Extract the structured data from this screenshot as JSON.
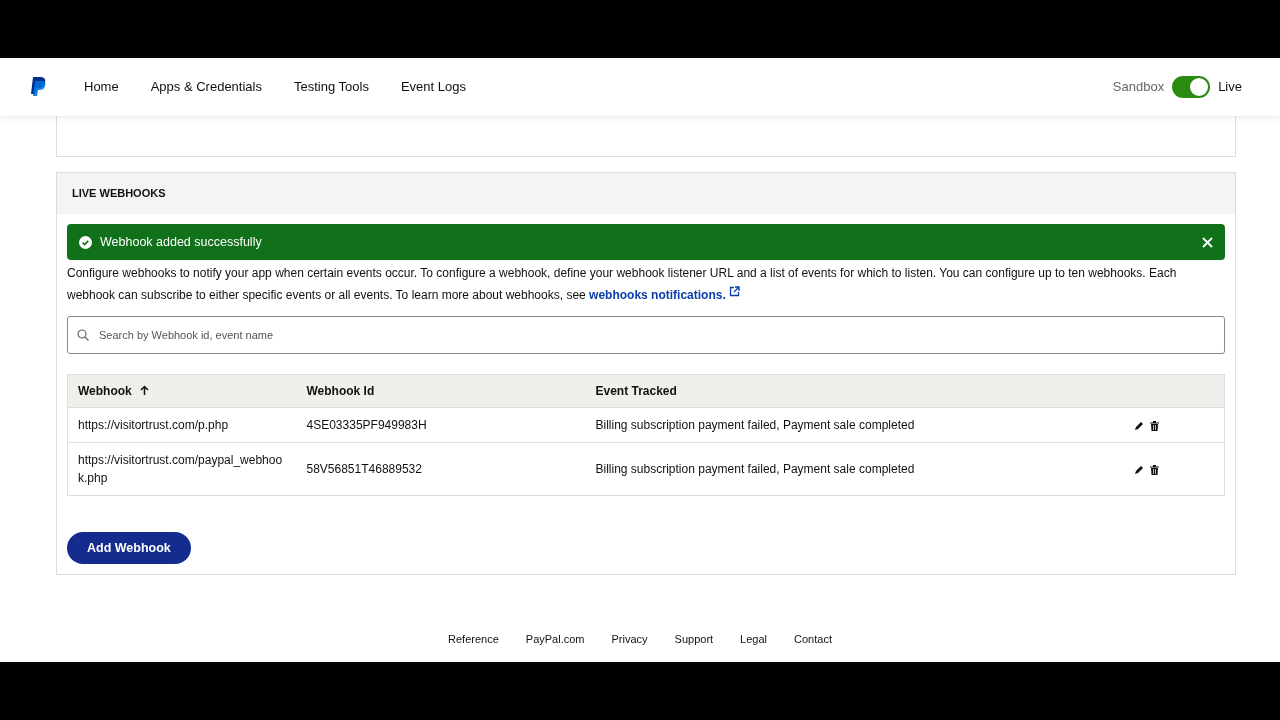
{
  "navbar": {
    "links": [
      {
        "label": "Home"
      },
      {
        "label": "Apps & Credentials"
      },
      {
        "label": "Testing Tools"
      },
      {
        "label": "Event Logs"
      }
    ],
    "mode_toggle": {
      "off_label": "Sandbox",
      "on_label": "Live",
      "on": true
    }
  },
  "section": {
    "title": "LIVE WEBHOOKS",
    "alert": {
      "message": "Webhook added successfully"
    },
    "description": "Configure webhooks to notify your app when certain events occur. To configure a webhook, define your webhook listener URL and a list of events for which to listen. You can configure up to ten webhooks. Each webhook can subscribe to either specific events or all events. To learn more about webhooks, see",
    "description_link": "webhooks notifications.",
    "search": {
      "placeholder": "Search by Webhook id, event name"
    },
    "table": {
      "columns": [
        {
          "label": "Webhook",
          "sorted": true
        },
        {
          "label": "Webhook Id",
          "sorted": false
        },
        {
          "label": "Event Tracked",
          "sorted": false
        }
      ],
      "rows": [
        {
          "cells": [
            "https://visitortrust.com/p.php",
            "4SE03335PF949983H",
            "Billing subscription payment failed, Payment sale completed"
          ]
        },
        {
          "cells": [
            "https://visitortrust.com/paypal_webhook.php",
            "58V56851T46889532",
            "Billing subscription payment failed, Payment sale completed"
          ]
        }
      ]
    },
    "add_button": "Add Webhook"
  },
  "footer": {
    "links": [
      "Reference",
      "PayPal.com",
      "Privacy",
      "Support",
      "Legal",
      "Contact"
    ]
  }
}
